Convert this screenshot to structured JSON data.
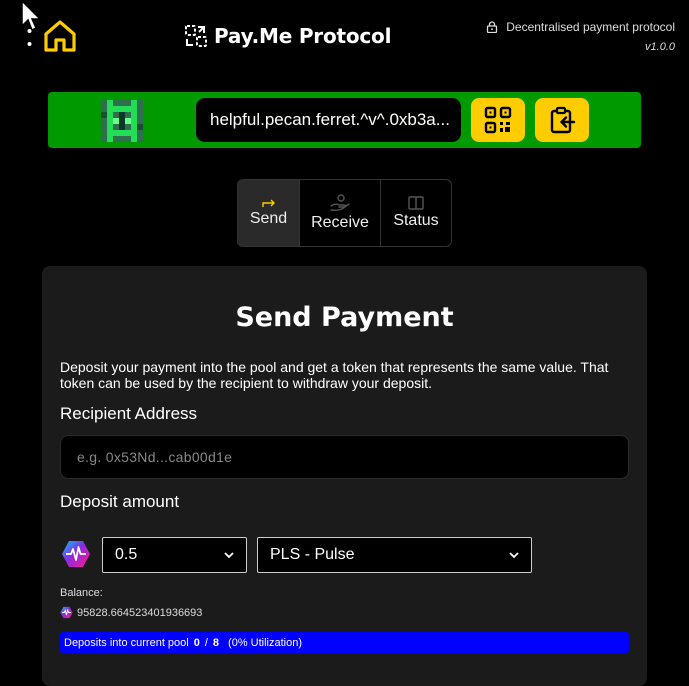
{
  "header": {
    "title": "Pay.Me Protocol",
    "tagline": "Decentralised payment protocol",
    "version": "v1.0.0"
  },
  "wallet": {
    "address": "helpful.pecan.ferret.^v^.0xb3a..."
  },
  "tabs": [
    {
      "label": "Send",
      "active": true
    },
    {
      "label": "Receive",
      "active": false
    },
    {
      "label": "Status",
      "active": false
    }
  ],
  "send": {
    "title": "Send Payment",
    "description": "Deposit your payment into the pool and get a token that represents the same value. That token can be used by the recipient to withdraw your deposit.",
    "recipient_label": "Recipient Address",
    "recipient_placeholder": "e.g. 0x53Nd...cab00d1e",
    "amount_label": "Deposit amount",
    "amount_value": "0.5",
    "token_value": "PLS - Pulse",
    "balance_label": "Balance:",
    "balance_value": "95828.664523401936693",
    "pool": {
      "label": "Deposits into current pool",
      "current": "0",
      "separator": "/",
      "max": "8",
      "utilization": "(0% Utilization)"
    }
  },
  "colors": {
    "accent_yellow": "#ffcc00",
    "wallet_bar_green": "#009900",
    "pool_bar_blue": "#0000ff"
  }
}
